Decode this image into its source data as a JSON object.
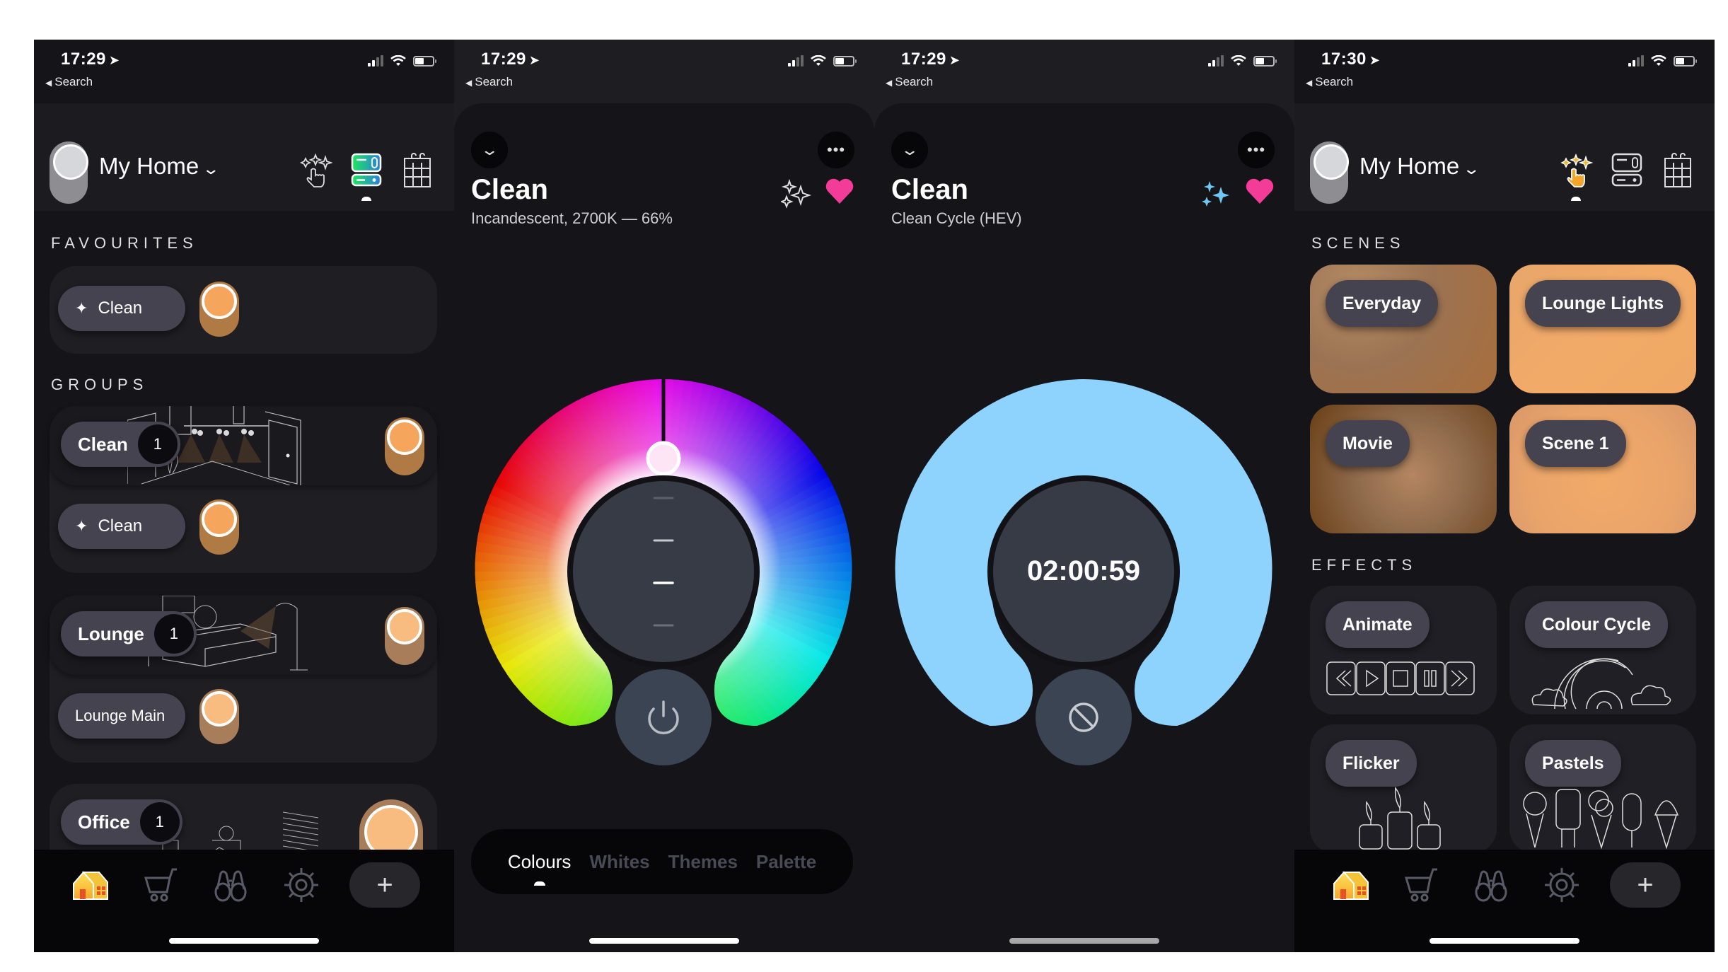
{
  "status_bars": [
    {
      "time": "17:29",
      "back_label": "Search"
    },
    {
      "time": "17:29",
      "back_label": "Search"
    },
    {
      "time": "17:29",
      "back_label": "Search"
    },
    {
      "time": "17:30",
      "back_label": "Search"
    }
  ],
  "home_screen": {
    "title": "My Home",
    "header_icons": [
      "scenes-hand-sparkle-icon",
      "devices-toggle-icon",
      "schedule-calendar-icon"
    ],
    "active_header_icon": "devices-toggle-icon",
    "favourites_label": "FAVOURITES",
    "favourites": [
      {
        "label": "Clean",
        "icon": "sparkles-icon",
        "on": true
      }
    ],
    "groups_label": "GROUPS",
    "groups": [
      {
        "name": "Clean",
        "count": "1",
        "on": true,
        "devices": [
          {
            "label": "Clean",
            "icon": "sparkles-icon",
            "on": true
          }
        ]
      },
      {
        "name": "Lounge",
        "count": "1",
        "on": true,
        "devices": [
          {
            "label": "Lounge Main",
            "on": true
          }
        ]
      },
      {
        "name": "Office",
        "count": "1",
        "on": true,
        "devices": []
      }
    ]
  },
  "tabbar": {
    "items": [
      "home-icon",
      "shop-cart-icon",
      "discover-binoculars-icon",
      "settings-gear-icon"
    ],
    "active": "home-icon",
    "add_label": "+"
  },
  "colour_screen": {
    "title": "Clean",
    "subtitle": "Incandescent, 2700K — 66%",
    "brightness_percent": 66,
    "mode_tabs": [
      "Colours",
      "Whites",
      "Themes",
      "Palette"
    ],
    "active_mode": "Colours"
  },
  "effect_screen": {
    "title": "Clean",
    "subtitle": "Clean Cycle (HEV)",
    "timer": "02:00:59",
    "ring_color": "#8dd3fe"
  },
  "scenes_screen": {
    "title": "My Home",
    "active_header_icon": "scenes-hand-sparkle-icon",
    "scenes_label": "SCENES",
    "scenes": [
      {
        "label": "Everyday"
      },
      {
        "label": "Lounge Lights"
      },
      {
        "label": "Movie"
      },
      {
        "label": "Scene 1"
      }
    ],
    "effects_label": "EFFECTS",
    "effects": [
      {
        "label": "Animate",
        "art": "media-controls"
      },
      {
        "label": "Colour Cycle",
        "art": "rainbow"
      },
      {
        "label": "Flicker",
        "art": "candles"
      },
      {
        "label": "Pastels",
        "art": "ice-creams"
      }
    ]
  },
  "colors": {
    "accent_orange": "#f6a55c",
    "heart_pink": "#f23c97",
    "sparkle_blue": "#6fc8f4",
    "background": "#141419"
  }
}
